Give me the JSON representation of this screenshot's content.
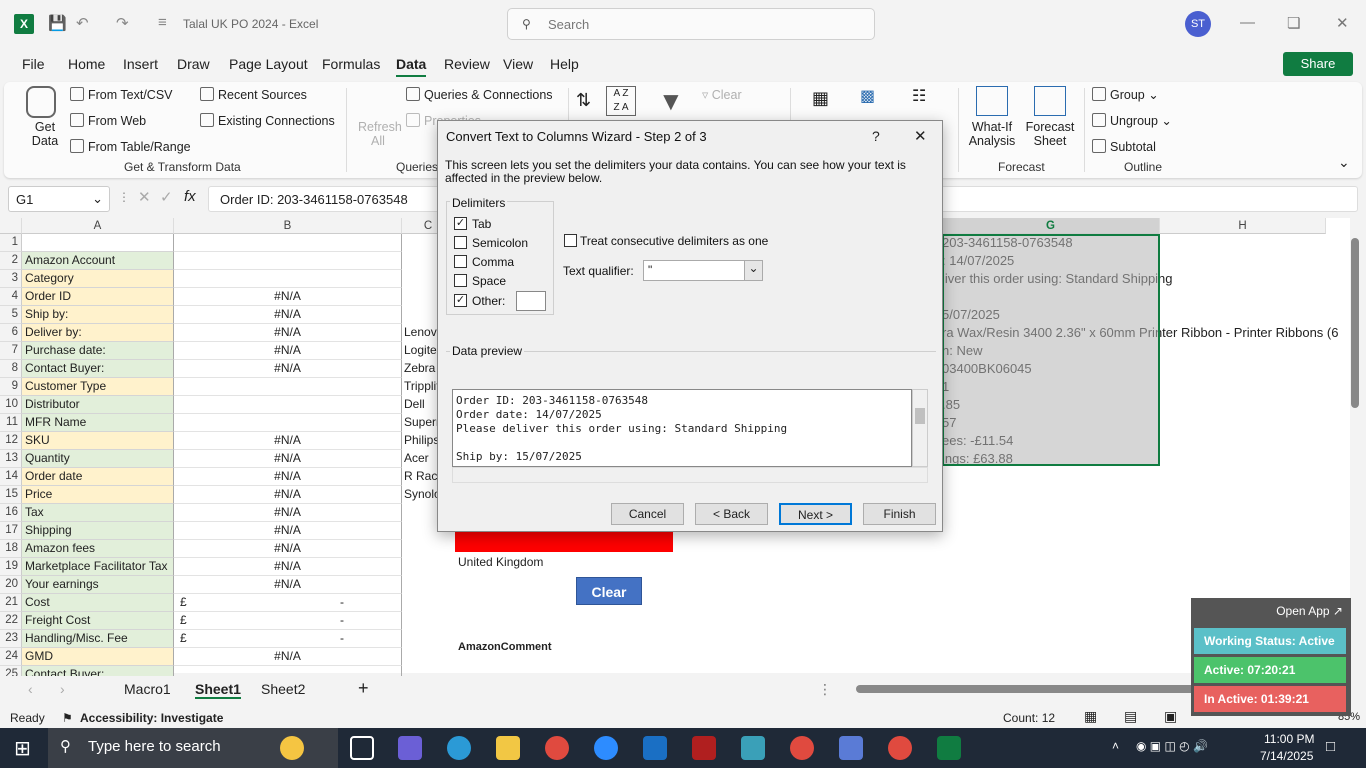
{
  "titlebar": {
    "doc_title": "Talal UK PO 2024  -  Excel",
    "search_placeholder": "Search",
    "avatar_initials": "ST"
  },
  "menu": [
    "File",
    "Home",
    "Insert",
    "Draw",
    "Page Layout",
    "Formulas",
    "Data",
    "Review",
    "View",
    "Help"
  ],
  "share_label": "Share",
  "ribbon": {
    "get_data": "Get Data",
    "from_text_csv": "From Text/CSV",
    "from_web": "From Web",
    "from_table_range": "From Table/Range",
    "recent_sources": "Recent Sources",
    "existing_connections": "Existing Connections",
    "group_get_transform": "Get & Transform Data",
    "refresh_all": "Refresh All",
    "queries_connections": "Queries & Connections",
    "properties": "Properties",
    "group_queries": "Queries",
    "clear": "Clear",
    "whatif": "What-If Analysis",
    "forecast_sheet": "Forecast Sheet",
    "group_forecast": "Forecast",
    "group": "Group",
    "ungroup": "Ungroup",
    "subtotal": "Subtotal",
    "group_outline": "Outline"
  },
  "formula_bar": {
    "name_box": "G1",
    "formula": "Order ID: 203-3461158-0763548"
  },
  "columns": [
    "A",
    "B",
    "C",
    "G",
    "H"
  ],
  "rows": [
    {
      "n": "1",
      "a": "",
      "b": "",
      "c": "",
      "g": "203-3461158-0763548"
    },
    {
      "n": "2",
      "a": "Amazon Account",
      "b": "",
      "c": "",
      "g": ": 14/07/2025"
    },
    {
      "n": "3",
      "a": "Category",
      "b": "",
      "c": "",
      "g": "liver this order using: Standard Shipping"
    },
    {
      "n": "4",
      "a": "Order ID",
      "b": "#N/A",
      "c": "",
      "g": ""
    },
    {
      "n": "5",
      "a": "Ship by:",
      "b": "#N/A",
      "c": "",
      "g": "5/07/2025"
    },
    {
      "n": "6",
      "a": "Deliver by:",
      "b": "#N/A",
      "c": "Lenovo",
      "g": "ra Wax/Resin 3400 2.36\" x 60mm Printer Ribbon - Printer Ribbons (6"
    },
    {
      "n": "7",
      "a": "Purchase date:",
      "b": "#N/A",
      "c": "Logitech",
      "g": "n: New"
    },
    {
      "n": "8",
      "a": "Contact Buyer:",
      "b": "#N/A",
      "c": "Zebra",
      "g": "03400BK06045"
    },
    {
      "n": "9",
      "a": "Customer Type",
      "b": "",
      "c": "Tripplite",
      "g": "1"
    },
    {
      "n": "10",
      "a": "Distributor",
      "b": "",
      "c": "Dell",
      "g": ".85"
    },
    {
      "n": "11",
      "a": "MFR Name",
      "b": "",
      "c": "Supermicro",
      "g": "57"
    },
    {
      "n": "12",
      "a": "SKU",
      "b": "#N/A",
      "c": "Philips",
      "g": "ees: -£11.54"
    },
    {
      "n": "13",
      "a": "Quantity",
      "b": "#N/A",
      "c": "Acer",
      "g": "ings: £63.88"
    },
    {
      "n": "14",
      "a": "Order date",
      "b": "#N/A",
      "c": "R Rack",
      "g": ""
    },
    {
      "n": "15",
      "a": "Price",
      "b": "#N/A",
      "c": "Synology",
      "g": ""
    },
    {
      "n": "16",
      "a": "Tax",
      "b": "#N/A",
      "c": "",
      "g": ""
    },
    {
      "n": "17",
      "a": "Shipping",
      "b": "#N/A",
      "c": "",
      "g": ""
    },
    {
      "n": "18",
      "a": "Amazon fees",
      "b": "#N/A",
      "c": "",
      "g": ""
    },
    {
      "n": "19",
      "a": "Marketplace Facilitator Tax",
      "b": "#N/A",
      "c": "",
      "g": ""
    },
    {
      "n": "20",
      "a": "Your earnings",
      "b": "#N/A",
      "c": "",
      "g": ""
    },
    {
      "n": "21",
      "a": "Cost",
      "b": "£                                              -",
      "c": "",
      "g": ""
    },
    {
      "n": "22",
      "a": "Freight Cost",
      "b": "£                                              -",
      "c": "",
      "g": ""
    },
    {
      "n": "23",
      "a": "Handling/Misc. Fee",
      "b": "£                                              -",
      "c": "",
      "g": ""
    },
    {
      "n": "24",
      "a": "GMD",
      "b": "#N/A",
      "c": "",
      "g": ""
    },
    {
      "n": "25",
      "a": "Contact Buyer:",
      "b": "",
      "c": "",
      "g": ""
    }
  ],
  "sheet_extras": {
    "country": "United Kingdom",
    "clear_button": "Clear",
    "amazon_comment": "AmazonComment"
  },
  "sheet_tabs": [
    "Macro1",
    "Sheet1",
    "Sheet2"
  ],
  "status": {
    "ready": "Ready",
    "accessibility": "Accessibility: Investigate",
    "count": "Count: 12",
    "zoom": "85%"
  },
  "dialog": {
    "title": "Convert Text to Columns Wizard - Step 2 of 3",
    "help": "?",
    "intro": "This screen lets you set the delimiters your data contains.  You can see how your text is affected in the preview below.",
    "delimiters_label": "Delimiters",
    "tab": "Tab",
    "semicolon": "Semicolon",
    "comma": "Comma",
    "space": "Space",
    "other": "Other:",
    "consecutive": "Treat consecutive delimiters as one",
    "qualifier_label": "Text qualifier:",
    "qualifier_value": "\"",
    "preview_label": "Data preview",
    "preview_text": "Order ID: 203-3461158-0763548\nOrder date: 14/07/2025\nPlease deliver this order using: Standard Shipping\n\nShip by: 15/07/2025",
    "cancel": "Cancel",
    "back": "< Back",
    "next": "Next >",
    "finish": "Finish"
  },
  "widget": {
    "open_app": "Open App ↗",
    "working": "Working Status: Active",
    "active": "Active: 07:20:21",
    "inactive": "In Active: 01:39:21"
  },
  "taskbar": {
    "search": "Type here to search",
    "time": "11:00 PM",
    "date": "7/14/2025"
  },
  "colors": {
    "excel_green": "#107c41",
    "label_green": "#e2efda",
    "label_yellow": "#fff2cc",
    "red_cell": "#ff0000",
    "clear_btn": "#4472c4"
  }
}
